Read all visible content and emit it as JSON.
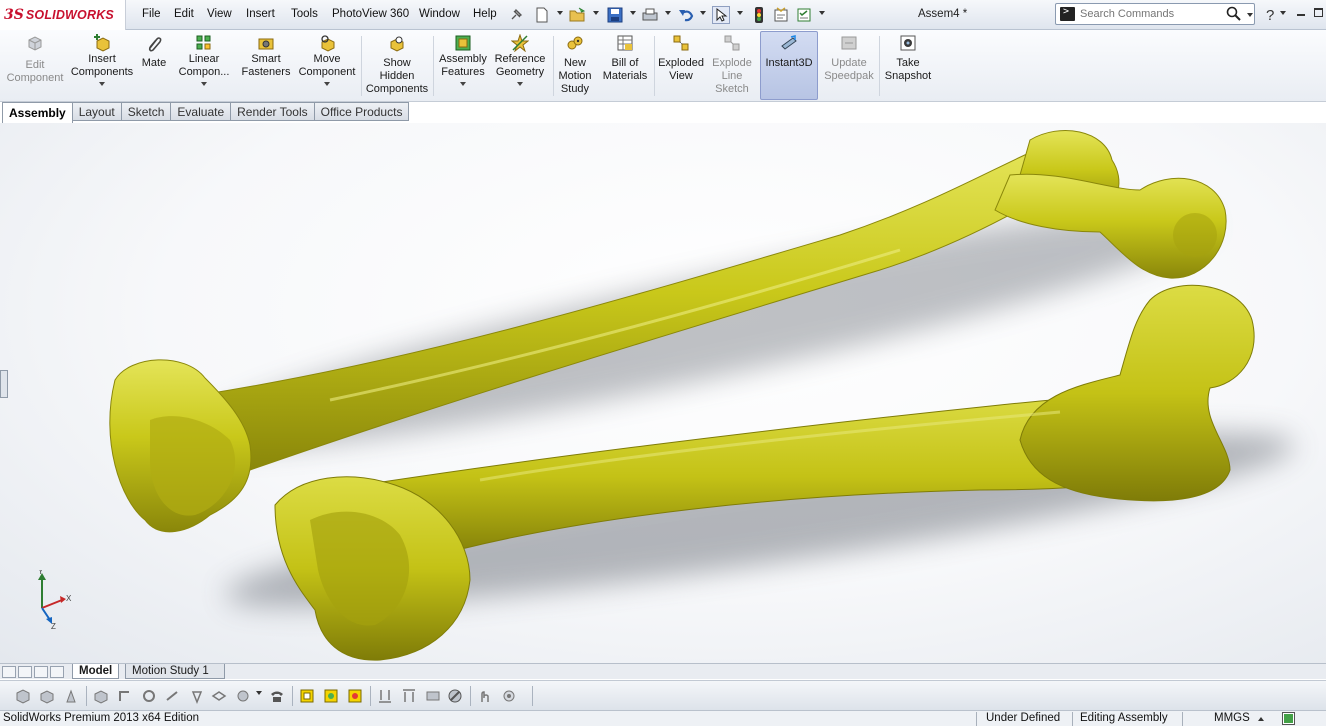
{
  "app": {
    "logo_ds": "3S",
    "logo_text": "SOLIDWORKS",
    "document_title": "Assem4 *"
  },
  "menu": [
    "File",
    "Edit",
    "View",
    "Insert",
    "Tools",
    "PhotoView 360",
    "Window",
    "Help"
  ],
  "search": {
    "placeholder": "Search Commands"
  },
  "command_manager": {
    "edit_component": "Edit\nComponent",
    "insert_components": "Insert\nComponents",
    "mate": "Mate",
    "linear_component": "Linear\nCompon...",
    "smart_fasteners": "Smart\nFasteners",
    "move_component": "Move\nComponent",
    "show_hidden": "Show\nHidden\nComponents",
    "assembly_features": "Assembly\nFeatures",
    "reference_geometry": "Reference\nGeometry",
    "new_motion_study": "New\nMotion\nStudy",
    "bill_of_materials": "Bill of\nMaterials",
    "exploded_view": "Exploded\nView",
    "explode_line_sketch": "Explode\nLine\nSketch",
    "instant3d": "Instant3D",
    "update_speedpak": "Update\nSpeedpak",
    "take_snapshot": "Take\nSnapshot"
  },
  "tabs": [
    "Assembly",
    "Layout",
    "Sketch",
    "Evaluate",
    "Render Tools",
    "Office Products"
  ],
  "bottom_tabs": [
    "Model",
    "Motion Study 1"
  ],
  "triad": {
    "x": "X",
    "y": "Y",
    "z": "Z"
  },
  "status": {
    "edition": "SolidWorks Premium 2013 x64 Edition",
    "state": "Under Defined",
    "mode": "Editing Assembly",
    "units": "MMGS"
  },
  "colors": {
    "bone": "#c9c81a",
    "bone_shadow": "#7d7a08",
    "bone_highlight": "#e6e65a",
    "brand": "#c8102e",
    "active_button": "#b7c4e4"
  },
  "icons": {
    "search": "magnifier-icon",
    "help": "question-icon",
    "instant3d": "instant3d-icon"
  }
}
